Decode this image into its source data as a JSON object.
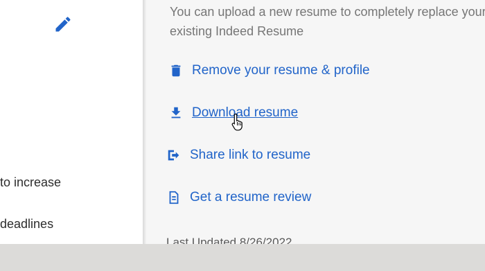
{
  "left": {
    "edit_icon": "pencil-icon",
    "line1": "to increase",
    "line2": "deadlines"
  },
  "right": {
    "intro": "You can upload a new resume to completely replace your existing Indeed Resume",
    "actions": [
      {
        "label": "Remove your resume & profile",
        "icon": "trash-icon"
      },
      {
        "label": "Download resume",
        "icon": "download-icon"
      },
      {
        "label": "Share link to resume",
        "icon": "share-icon"
      },
      {
        "label": "Get a resume review",
        "icon": "document-icon"
      }
    ],
    "last_updated": "Last Updated 8/26/2022"
  },
  "colors": {
    "link": "#2164c9",
    "text_muted": "#767676",
    "panel_bg": "#f6f6f6"
  }
}
